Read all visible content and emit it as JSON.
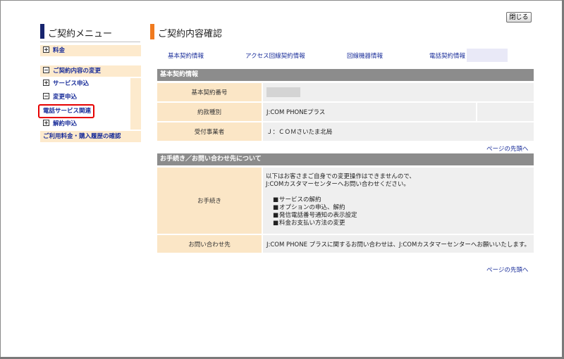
{
  "window": {
    "close_label": "閉じる"
  },
  "sidebar": {
    "title": "ご契約メニュー",
    "items": [
      {
        "label": "料金",
        "toggle": "plus"
      },
      {
        "label": "ご契約内容の変更",
        "toggle": "minus"
      },
      {
        "label": "サービス申込",
        "toggle": "plus"
      },
      {
        "label": "変更申込",
        "toggle": "minus"
      },
      {
        "label": "電話サービス関連",
        "toggle": "none"
      },
      {
        "label": "解約申込",
        "toggle": "plus"
      },
      {
        "label": "ご利用料金・購入履歴の確認",
        "toggle": "none"
      }
    ]
  },
  "main": {
    "title": "ご契約内容確認",
    "tabs": [
      {
        "label": "基本契約情報"
      },
      {
        "label": "アクセス回線契約情報"
      },
      {
        "label": "回線機器情報"
      },
      {
        "label": "電話契約情報"
      }
    ],
    "basic": {
      "header": "基本契約情報",
      "rows": [
        {
          "label": "基本契約番号",
          "value": ""
        },
        {
          "label": "約款種別",
          "value": "J:COM PHONEプラス"
        },
        {
          "label": "受付事業者",
          "value": "Ｊ：ＣＯＭさいたま北局"
        }
      ],
      "top_link": "ページの先頭へ"
    },
    "procedures": {
      "header": "お手続き／お問い合わせ先について",
      "proc_label": "お手続き",
      "proc_intro_1": "以下はお客さまご自身での変更操作はできませんので、",
      "proc_intro_2": "J:COMカスタマーセンターへお問い合わせください。",
      "proc_items": [
        "サービスの解約",
        "オプションの申込、解約",
        "発信電話番号通知の表示設定",
        "料金お支払い方法の変更"
      ],
      "contact_label": "お問い合わせ先",
      "contact_value": "J:COM PHONE プラスに関するお問い合わせは、J:COMカスタマーセンターへお願いいたします。",
      "top_link": "ページの先頭へ"
    }
  },
  "colors": {
    "sidebar_accent": "#17246e",
    "main_accent": "#f07a1e",
    "menu_bg": "#fdeacd",
    "link": "#1a2e9a",
    "section_header": "#8c8c8c",
    "highlight": "#e60000"
  }
}
